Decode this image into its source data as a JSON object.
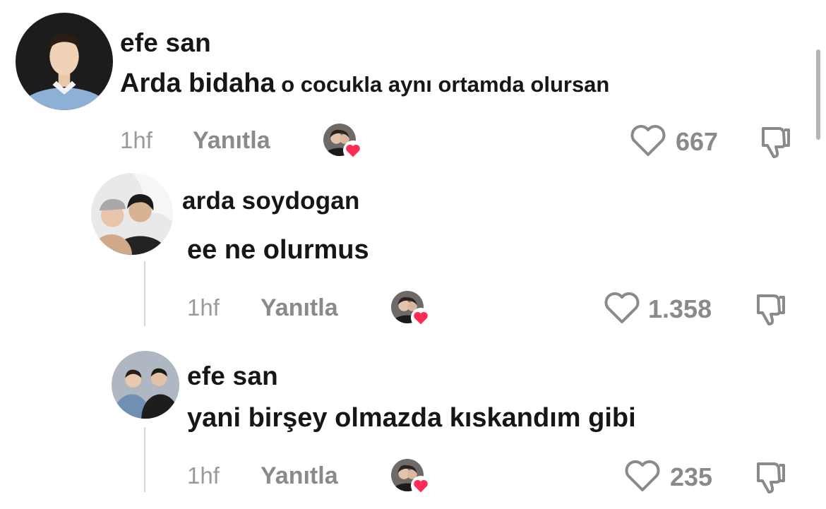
{
  "comments": [
    {
      "username": "efe san",
      "text_main": "Arda bidaha",
      "text_rest": " o cocukla aynı ortamda olursan",
      "time": "1hf",
      "reply_label": "Yanıtla",
      "like_count": "667"
    },
    {
      "username": "arda soydogan",
      "text_main": "ee ne olurmus",
      "time": "1hf",
      "reply_label": "Yanıtla",
      "like_count": "1.358"
    },
    {
      "username": "efe san",
      "text_main": "yani birşey olmazda kıskandım gibi",
      "time": "1hf",
      "reply_label": "Yanıtla",
      "like_count": "235"
    }
  ],
  "icons": {
    "like": "heart-outline-icon",
    "dislike": "thumbs-down-icon",
    "creator_liked": "creator-heart-badge-icon"
  },
  "colors": {
    "text": "#161616",
    "meta": "#8a8a8a",
    "heart_badge": "#fe2c55"
  }
}
